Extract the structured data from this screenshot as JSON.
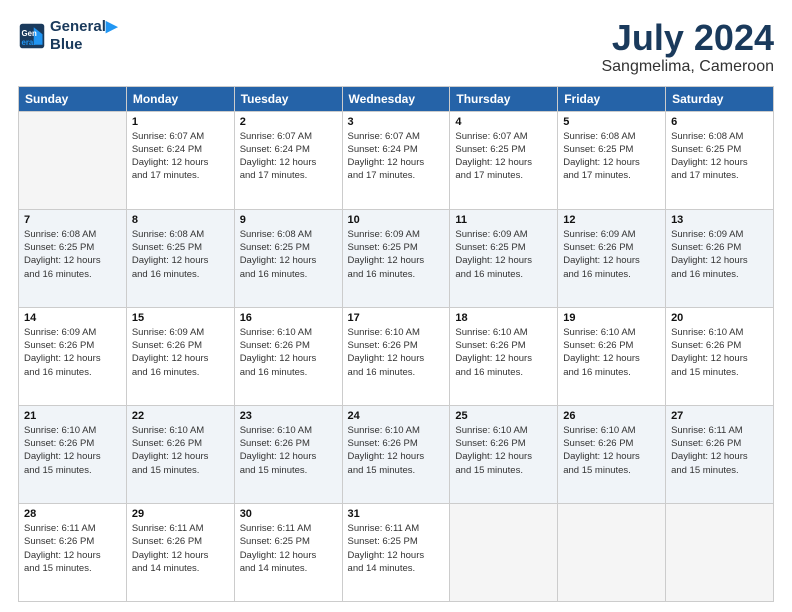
{
  "header": {
    "logo_line1": "General",
    "logo_line2": "Blue",
    "title": "July 2024",
    "subtitle": "Sangmelima, Cameroon"
  },
  "weekdays": [
    "Sunday",
    "Monday",
    "Tuesday",
    "Wednesday",
    "Thursday",
    "Friday",
    "Saturday"
  ],
  "weeks": [
    [
      {
        "day": "",
        "info": ""
      },
      {
        "day": "1",
        "info": "Sunrise: 6:07 AM\nSunset: 6:24 PM\nDaylight: 12 hours\nand 17 minutes."
      },
      {
        "day": "2",
        "info": "Sunrise: 6:07 AM\nSunset: 6:24 PM\nDaylight: 12 hours\nand 17 minutes."
      },
      {
        "day": "3",
        "info": "Sunrise: 6:07 AM\nSunset: 6:24 PM\nDaylight: 12 hours\nand 17 minutes."
      },
      {
        "day": "4",
        "info": "Sunrise: 6:07 AM\nSunset: 6:25 PM\nDaylight: 12 hours\nand 17 minutes."
      },
      {
        "day": "5",
        "info": "Sunrise: 6:08 AM\nSunset: 6:25 PM\nDaylight: 12 hours\nand 17 minutes."
      },
      {
        "day": "6",
        "info": "Sunrise: 6:08 AM\nSunset: 6:25 PM\nDaylight: 12 hours\nand 17 minutes."
      }
    ],
    [
      {
        "day": "7",
        "info": "Sunrise: 6:08 AM\nSunset: 6:25 PM\nDaylight: 12 hours\nand 16 minutes."
      },
      {
        "day": "8",
        "info": "Sunrise: 6:08 AM\nSunset: 6:25 PM\nDaylight: 12 hours\nand 16 minutes."
      },
      {
        "day": "9",
        "info": "Sunrise: 6:08 AM\nSunset: 6:25 PM\nDaylight: 12 hours\nand 16 minutes."
      },
      {
        "day": "10",
        "info": "Sunrise: 6:09 AM\nSunset: 6:25 PM\nDaylight: 12 hours\nand 16 minutes."
      },
      {
        "day": "11",
        "info": "Sunrise: 6:09 AM\nSunset: 6:25 PM\nDaylight: 12 hours\nand 16 minutes."
      },
      {
        "day": "12",
        "info": "Sunrise: 6:09 AM\nSunset: 6:26 PM\nDaylight: 12 hours\nand 16 minutes."
      },
      {
        "day": "13",
        "info": "Sunrise: 6:09 AM\nSunset: 6:26 PM\nDaylight: 12 hours\nand 16 minutes."
      }
    ],
    [
      {
        "day": "14",
        "info": "Sunrise: 6:09 AM\nSunset: 6:26 PM\nDaylight: 12 hours\nand 16 minutes."
      },
      {
        "day": "15",
        "info": "Sunrise: 6:09 AM\nSunset: 6:26 PM\nDaylight: 12 hours\nand 16 minutes."
      },
      {
        "day": "16",
        "info": "Sunrise: 6:10 AM\nSunset: 6:26 PM\nDaylight: 12 hours\nand 16 minutes."
      },
      {
        "day": "17",
        "info": "Sunrise: 6:10 AM\nSunset: 6:26 PM\nDaylight: 12 hours\nand 16 minutes."
      },
      {
        "day": "18",
        "info": "Sunrise: 6:10 AM\nSunset: 6:26 PM\nDaylight: 12 hours\nand 16 minutes."
      },
      {
        "day": "19",
        "info": "Sunrise: 6:10 AM\nSunset: 6:26 PM\nDaylight: 12 hours\nand 16 minutes."
      },
      {
        "day": "20",
        "info": "Sunrise: 6:10 AM\nSunset: 6:26 PM\nDaylight: 12 hours\nand 15 minutes."
      }
    ],
    [
      {
        "day": "21",
        "info": "Sunrise: 6:10 AM\nSunset: 6:26 PM\nDaylight: 12 hours\nand 15 minutes."
      },
      {
        "day": "22",
        "info": "Sunrise: 6:10 AM\nSunset: 6:26 PM\nDaylight: 12 hours\nand 15 minutes."
      },
      {
        "day": "23",
        "info": "Sunrise: 6:10 AM\nSunset: 6:26 PM\nDaylight: 12 hours\nand 15 minutes."
      },
      {
        "day": "24",
        "info": "Sunrise: 6:10 AM\nSunset: 6:26 PM\nDaylight: 12 hours\nand 15 minutes."
      },
      {
        "day": "25",
        "info": "Sunrise: 6:10 AM\nSunset: 6:26 PM\nDaylight: 12 hours\nand 15 minutes."
      },
      {
        "day": "26",
        "info": "Sunrise: 6:10 AM\nSunset: 6:26 PM\nDaylight: 12 hours\nand 15 minutes."
      },
      {
        "day": "27",
        "info": "Sunrise: 6:11 AM\nSunset: 6:26 PM\nDaylight: 12 hours\nand 15 minutes."
      }
    ],
    [
      {
        "day": "28",
        "info": "Sunrise: 6:11 AM\nSunset: 6:26 PM\nDaylight: 12 hours\nand 15 minutes."
      },
      {
        "day": "29",
        "info": "Sunrise: 6:11 AM\nSunset: 6:26 PM\nDaylight: 12 hours\nand 14 minutes."
      },
      {
        "day": "30",
        "info": "Sunrise: 6:11 AM\nSunset: 6:25 PM\nDaylight: 12 hours\nand 14 minutes."
      },
      {
        "day": "31",
        "info": "Sunrise: 6:11 AM\nSunset: 6:25 PM\nDaylight: 12 hours\nand 14 minutes."
      },
      {
        "day": "",
        "info": ""
      },
      {
        "day": "",
        "info": ""
      },
      {
        "day": "",
        "info": ""
      }
    ]
  ]
}
